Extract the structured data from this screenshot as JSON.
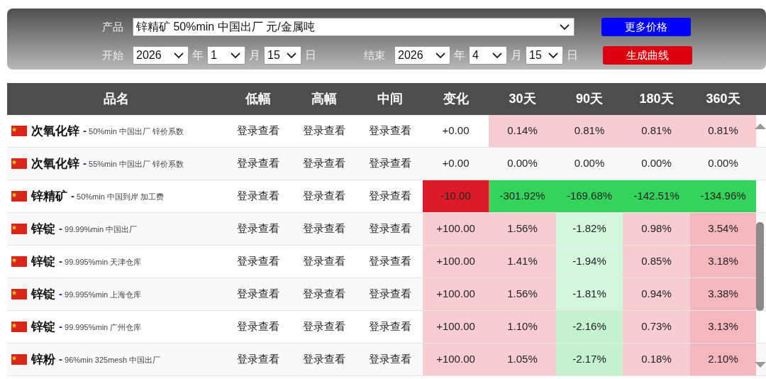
{
  "filter": {
    "product_label": "产品",
    "product": "锌精矿 50%min 中国出厂 元/金属吨",
    "more_button": "更多价格",
    "start_label": "开始",
    "start": [
      {
        "value": "2026",
        "unit": "年"
      },
      {
        "value": "1",
        "unit": "月"
      },
      {
        "value": "15",
        "unit": "日"
      }
    ],
    "end_label": "结束",
    "end": [
      {
        "value": "2026",
        "unit": "年"
      },
      {
        "value": "4",
        "unit": "月"
      },
      {
        "value": "15",
        "unit": "日"
      }
    ],
    "curve_button": "生成曲线"
  },
  "table": {
    "columns": [
      "品名",
      "低幅",
      "高幅",
      "中间",
      "变化",
      "30天",
      "90天",
      "180天",
      "360天"
    ],
    "rows": [
      {
        "name": "次氧化锌",
        "spec": "- 50%min 中国出厂 锌价系数",
        "low": "登录查看",
        "high": "登录查看",
        "mid": "登录查看",
        "change": {
          "text": "+0.00",
          "color": "#ffffff"
        },
        "periods": [
          {
            "text": "0.14%",
            "color": "#f8cdd2"
          },
          {
            "text": "0.81%",
            "color": "#f8cdd2"
          },
          {
            "text": "0.81%",
            "color": "#f8cdd2"
          },
          {
            "text": "0.81%",
            "color": "#f8cdd2"
          }
        ]
      },
      {
        "name": "次氧化锌",
        "spec": "- 55%min 中国出厂 锌价系数",
        "low": "登录查看",
        "high": "登录查看",
        "mid": "登录查看",
        "change": {
          "text": "+0.00",
          "color": "#f9f9f9"
        },
        "periods": [
          {
            "text": "0.00%",
            "color": "#f9f9f9"
          },
          {
            "text": "0.00%",
            "color": "#f9f9f9"
          },
          {
            "text": "0.00%",
            "color": "#f9f9f9"
          },
          {
            "text": "0.00%",
            "color": "#f9f9f9"
          }
        ]
      },
      {
        "name": "锌精矿",
        "spec": "- 50%min 中国到岸 加工费",
        "low": "登录查看",
        "high": "登录查看",
        "mid": "登录查看",
        "change": {
          "text": "-10.00",
          "color": "#dc1b28"
        },
        "periods": [
          {
            "text": "-301.92%",
            "color": "#34d45c"
          },
          {
            "text": "-169.68%",
            "color": "#34d45c"
          },
          {
            "text": "-142.51%",
            "color": "#34d45c"
          },
          {
            "text": "-134.96%",
            "color": "#34d45c"
          }
        ]
      },
      {
        "name": "锌锭",
        "spec": "- 99.99%min 中国出厂",
        "low": "登录查看",
        "high": "登录查看",
        "mid": "登录查看",
        "change": {
          "text": "+100.00",
          "color": "#f8cdd2"
        },
        "periods": [
          {
            "text": "1.56%",
            "color": "#f8cdd2"
          },
          {
            "text": "-1.82%",
            "color": "#d4f6dd"
          },
          {
            "text": "0.98%",
            "color": "#f8cdd2"
          },
          {
            "text": "3.54%",
            "color": "#f4b7bd"
          }
        ]
      },
      {
        "name": "锌锭",
        "spec": "- 99.995%min 天津仓库",
        "low": "登录查看",
        "high": "登录查看",
        "mid": "登录查看",
        "change": {
          "text": "+100.00",
          "color": "#f8cdd2"
        },
        "periods": [
          {
            "text": "1.41%",
            "color": "#f8cdd2"
          },
          {
            "text": "-1.94%",
            "color": "#d4f6dd"
          },
          {
            "text": "0.85%",
            "color": "#f8cdd2"
          },
          {
            "text": "3.18%",
            "color": "#f4b7bd"
          }
        ]
      },
      {
        "name": "锌锭",
        "spec": "- 99.995%min 上海仓库",
        "low": "登录查看",
        "high": "登录查看",
        "mid": "登录查看",
        "change": {
          "text": "+100.00",
          "color": "#f8cdd2"
        },
        "periods": [
          {
            "text": "1.56%",
            "color": "#f8cdd2"
          },
          {
            "text": "-1.81%",
            "color": "#d4f6dd"
          },
          {
            "text": "0.94%",
            "color": "#f8cdd2"
          },
          {
            "text": "3.38%",
            "color": "#f4b7bd"
          }
        ]
      },
      {
        "name": "锌锭",
        "spec": "- 99.995%min 广州仓库",
        "low": "登录查看",
        "high": "登录查看",
        "mid": "登录查看",
        "change": {
          "text": "+100.00",
          "color": "#f8cdd2"
        },
        "periods": [
          {
            "text": "1.10%",
            "color": "#f8cdd2"
          },
          {
            "text": "-2.16%",
            "color": "#c4f1d0"
          },
          {
            "text": "0.73%",
            "color": "#f8cdd2"
          },
          {
            "text": "3.13%",
            "color": "#f4b7bd"
          }
        ]
      },
      {
        "name": "锌粉",
        "spec": "- 96%min 325mesh 中国出厂",
        "low": "登录查看",
        "high": "登录查看",
        "mid": "登录查看",
        "change": {
          "text": "+100.00",
          "color": "#f8cdd2"
        },
        "periods": [
          {
            "text": "1.05%",
            "color": "#f8cdd2"
          },
          {
            "text": "-2.17%",
            "color": "#c4f1d0"
          },
          {
            "text": "0.18%",
            "color": "#f8cdd2"
          },
          {
            "text": "2.10%",
            "color": "#f4b7bd"
          }
        ]
      }
    ]
  }
}
